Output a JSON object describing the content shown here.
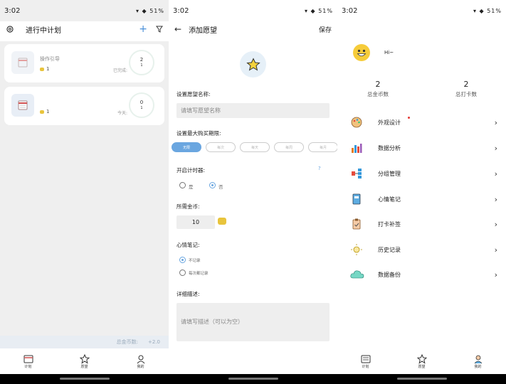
{
  "status": {
    "time": "3:02",
    "battery": "51%"
  },
  "screen1": {
    "title": "进行中计划",
    "cards": [
      {
        "name": "操作引导",
        "coins": "1",
        "counter_top": "2",
        "counter_bottom": "1",
        "label": "已完成:"
      },
      {
        "name": "",
        "coins": "1",
        "counter_top": "0",
        "counter_bottom": "1",
        "label": "今天:"
      }
    ],
    "footer_label": "总金币数:",
    "footer_value": "+2.0",
    "nav": [
      "计划",
      "愿望",
      "我的"
    ]
  },
  "screen2": {
    "back": "←",
    "title": "添加愿望",
    "save": "保存",
    "name_label": "设置愿望名称:",
    "name_placeholder": "请填写愿望名称",
    "limit_label": "设置最大购买期限:",
    "limit_options": [
      "无限",
      "每次",
      "每天",
      "每周",
      "每月"
    ],
    "timer_label": "开启计时器:",
    "help": "?",
    "yes": "是",
    "no": "否",
    "coins_label": "所需金币:",
    "coins_value": "10",
    "mood_label": "心情笔记:",
    "mood_opt1": "不记录",
    "mood_opt2": "每次都记录",
    "desc_label": "详细描述:",
    "desc_placeholder": "请填写描述（可以为空）"
  },
  "screen3": {
    "greeting": "Hi~",
    "total_coins_value": "2",
    "total_coins_label": "总金币数",
    "total_checkins_value": "2",
    "total_checkins_label": "总打卡数",
    "menu": [
      "外观设计",
      "数据分析",
      "分组管理",
      "心情笔记",
      "打卡补签",
      "历史记录",
      "数据备份"
    ],
    "nav": [
      "计划",
      "愿望",
      "我的"
    ]
  },
  "colors": {
    "accent": "#6aa6e0",
    "coin": "#e8c43c",
    "badge": "#e53935"
  }
}
